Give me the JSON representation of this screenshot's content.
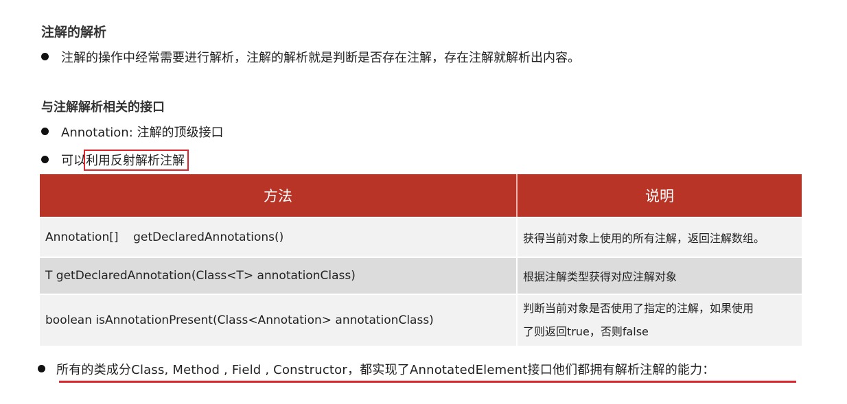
{
  "heading": "注解的解析",
  "bullet1": "注解的操作中经常需要进行解析，注解的解析就是判断是否存在注解，存在注解就解析出内容。",
  "subheading": "与注解解析相关的接口",
  "bullet2": "Annotation: 注解的顶级接口",
  "bullet3_prefix": "可以",
  "bullet3_highlight": "利用反射解析注解",
  "table": {
    "headers": [
      "方法",
      "说明"
    ],
    "rows": [
      {
        "method": "Annotation[]    getDeclaredAnnotations()",
        "desc": "获得当前对象上使用的所有注解，返回注解数组。"
      },
      {
        "method": "T getDeclaredAnnotation(Class<T> annotationClass)",
        "desc": "根据注解类型获得对应注解对象"
      },
      {
        "method": "boolean isAnnotationPresent(Class<Annotation> annotationClass)",
        "desc_line1": "判断当前对象是否使用了指定的注解，如果使用",
        "desc_line2": "了则返回true，否则false"
      }
    ]
  },
  "bullet4": "所有的类成分Class, Method , Field , Constructor，都实现了AnnotatedElement接口他们都拥有解析注解的能力：",
  "colors": {
    "header_bg": "#b83426",
    "highlight_red": "#d9252b"
  }
}
